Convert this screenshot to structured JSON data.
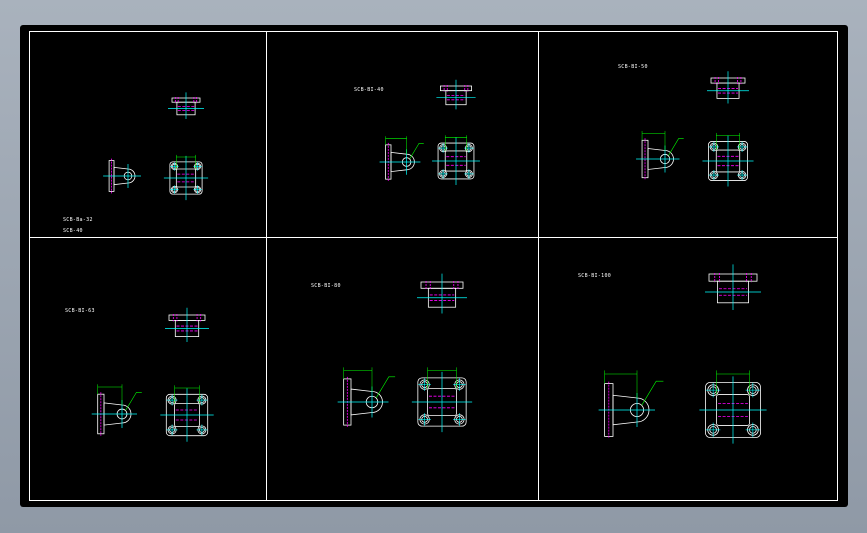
{
  "drawing": {
    "background": "#000000",
    "colors": {
      "outline": "#ffffff",
      "center": "#00ffff",
      "hidden": "#ff00ff",
      "dimension": "#00ff00"
    },
    "cells": [
      {
        "id": "cell-1",
        "label_lines": [
          "SCB-Ba-32",
          "SCB-40"
        ]
      },
      {
        "id": "cell-2",
        "label_lines": [
          "SCB-BI-40"
        ]
      },
      {
        "id": "cell-3",
        "label_lines": [
          "SCB-BI-50"
        ]
      },
      {
        "id": "cell-4",
        "label_lines": [
          "SCB-BI-63"
        ]
      },
      {
        "id": "cell-5",
        "label_lines": [
          "SCB-BI-80"
        ]
      },
      {
        "id": "cell-6",
        "label_lines": [
          "SCB-BI-100"
        ]
      }
    ]
  }
}
